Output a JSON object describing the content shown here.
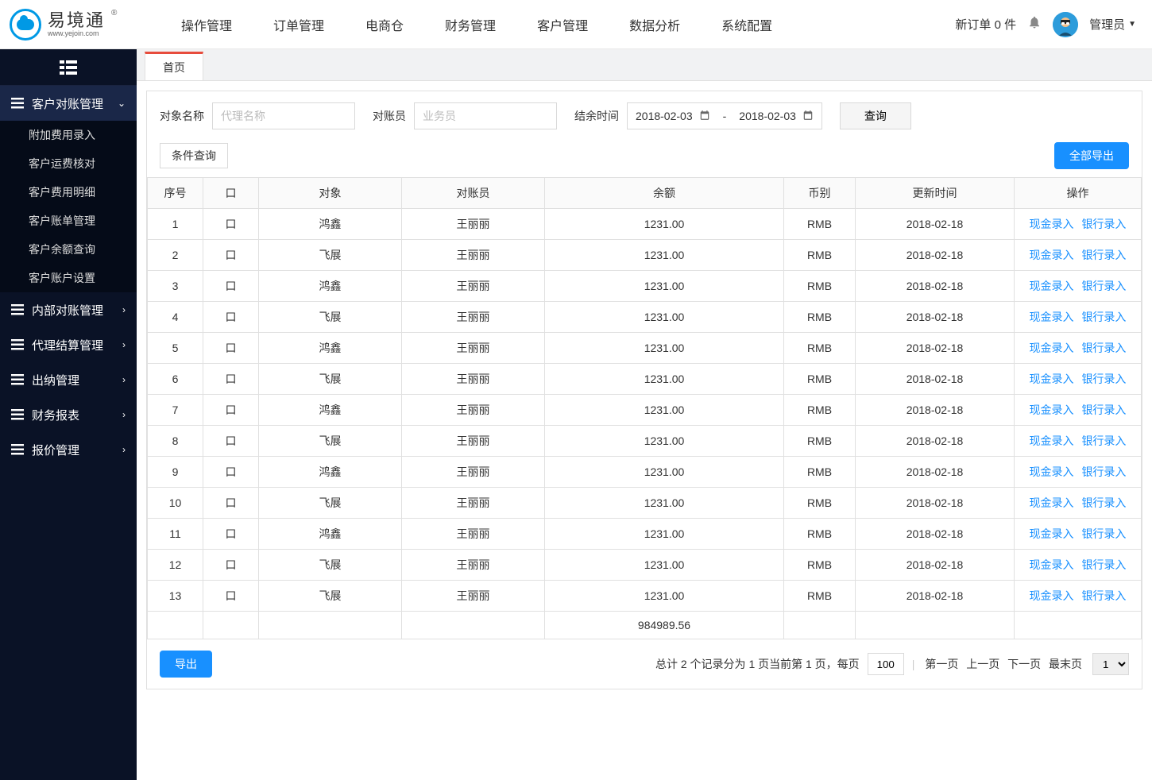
{
  "logo": {
    "name": "易境通",
    "url": "www.yejoin.com",
    "reg": "®"
  },
  "topnav": [
    "操作管理",
    "订单管理",
    "电商仓",
    "财务管理",
    "客户管理",
    "数据分析",
    "系统配置"
  ],
  "header_right": {
    "new_orders_prefix": "新订单 ",
    "new_orders_count": "0",
    "new_orders_suffix": " 件",
    "role": "管理员"
  },
  "sidebar": {
    "groups": [
      {
        "label": "客户对账管理",
        "open": true,
        "items": [
          "附加费用录入",
          "客户运费核对",
          "客户费用明细",
          "客户账单管理",
          "客户余额查询",
          "客户账户设置"
        ]
      },
      {
        "label": "内部对账管理",
        "open": false
      },
      {
        "label": "代理结算管理",
        "open": false
      },
      {
        "label": "出纳管理",
        "open": false
      },
      {
        "label": "财务报表",
        "open": false
      },
      {
        "label": "报价管理",
        "open": false
      }
    ]
  },
  "tab": {
    "label": "首页"
  },
  "filter": {
    "obj_name_label": "对象名称",
    "obj_name_placeholder": "代理名称",
    "reconciler_label": "对账员",
    "reconciler_placeholder": "业务员",
    "balance_time_label": "结余时间",
    "date_from": "2018-02-03",
    "date_to": "2018-02-03",
    "query_btn": "查询",
    "condition_query": "条件查询",
    "export_all": "全部导出"
  },
  "table": {
    "headers": [
      "序号",
      "口",
      "对象",
      "对账员",
      "余额",
      "币别",
      "更新时间",
      "操作"
    ],
    "rows": [
      {
        "no": "1",
        "chk": "口",
        "obj": "鸿鑫",
        "rec": "王丽丽",
        "bal": "1231.00",
        "cur": "RMB",
        "time": "2018-02-18"
      },
      {
        "no": "2",
        "chk": "口",
        "obj": "飞展",
        "rec": "王丽丽",
        "bal": "1231.00",
        "cur": "RMB",
        "time": "2018-02-18"
      },
      {
        "no": "3",
        "chk": "口",
        "obj": "鸿鑫",
        "rec": "王丽丽",
        "bal": "1231.00",
        "cur": "RMB",
        "time": "2018-02-18"
      },
      {
        "no": "4",
        "chk": "口",
        "obj": "飞展",
        "rec": "王丽丽",
        "bal": "1231.00",
        "cur": "RMB",
        "time": "2018-02-18"
      },
      {
        "no": "5",
        "chk": "口",
        "obj": "鸿鑫",
        "rec": "王丽丽",
        "bal": "1231.00",
        "cur": "RMB",
        "time": "2018-02-18"
      },
      {
        "no": "6",
        "chk": "口",
        "obj": "飞展",
        "rec": "王丽丽",
        "bal": "1231.00",
        "cur": "RMB",
        "time": "2018-02-18"
      },
      {
        "no": "7",
        "chk": "口",
        "obj": "鸿鑫",
        "rec": "王丽丽",
        "bal": "1231.00",
        "cur": "RMB",
        "time": "2018-02-18"
      },
      {
        "no": "8",
        "chk": "口",
        "obj": "飞展",
        "rec": "王丽丽",
        "bal": "1231.00",
        "cur": "RMB",
        "time": "2018-02-18"
      },
      {
        "no": "9",
        "chk": "口",
        "obj": "鸿鑫",
        "rec": "王丽丽",
        "bal": "1231.00",
        "cur": "RMB",
        "time": "2018-02-18"
      },
      {
        "no": "10",
        "chk": "口",
        "obj": "飞展",
        "rec": "王丽丽",
        "bal": "1231.00",
        "cur": "RMB",
        "time": "2018-02-18"
      },
      {
        "no": "11",
        "chk": "口",
        "obj": "鸿鑫",
        "rec": "王丽丽",
        "bal": "1231.00",
        "cur": "RMB",
        "time": "2018-02-18"
      },
      {
        "no": "12",
        "chk": "口",
        "obj": "飞展",
        "rec": "王丽丽",
        "bal": "1231.00",
        "cur": "RMB",
        "time": "2018-02-18"
      },
      {
        "no": "13",
        "chk": "口",
        "obj": "飞展",
        "rec": "王丽丽",
        "bal": "1231.00",
        "cur": "RMB",
        "time": "2018-02-18"
      }
    ],
    "total_balance": "984989.56",
    "action_cash": "现金录入",
    "action_bank": "银行录入"
  },
  "footer": {
    "export_btn": "导出",
    "summary": "总计 2 个记录分为 1 页当前第 1 页，每页",
    "per_page": "100",
    "first": "第一页",
    "prev": "上一页",
    "next": "下一页",
    "last": "最末页",
    "page_select": "1"
  }
}
